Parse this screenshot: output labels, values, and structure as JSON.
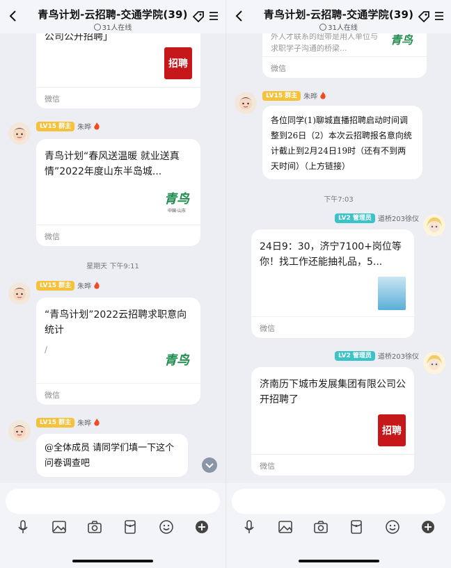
{
  "left": {
    "header": {
      "title": "青鸟计划-云招聘-交通学院(39)",
      "online": "31人在线"
    },
    "card0": {
      "text": "公司公开招聘」",
      "logo": "招聘",
      "footer": "微信"
    },
    "msg1": {
      "level": "LV15 群主",
      "name": "朱晔",
      "text": "青鸟计划“春风送温暖 就业送真情”2022年度山东半岛城...",
      "logo": "青鸟",
      "logo_sub": "中国·山东",
      "footer": "微信"
    },
    "time1": "星期天 下午9:11",
    "msg2": {
      "level": "LV15 群主",
      "name": "朱晔",
      "text": "“青鸟计划”2022云招聘求职意向统计",
      "sub": "/",
      "logo": "青鸟",
      "footer": "微信"
    },
    "msg3": {
      "level": "LV15 群主",
      "name": "朱晔",
      "text": "@全体成员 请同学们填一下这个问卷调查吧"
    }
  },
  "right": {
    "header": {
      "title": "青鸟计划-云招聘-交通学院(39)",
      "online": "31人在线"
    },
    "card0": {
      "text": "外人才联系的纽带是用人单位与求职学子沟通的桥梁...",
      "logo": "青鸟",
      "footer": "微信"
    },
    "msg1": {
      "level": "LV15 群主",
      "name": "朱晔",
      "text": "各位同学(1)聊城直播招聘启动时间调整到26日（2）本次云招聘报名意向统计截止到2月24日19时（还有不到两天时间）（上方链接）"
    },
    "time1": "下午7:03",
    "msg2": {
      "level": "LV2 管理员",
      "name": "道桥203徐仪",
      "text": "24日9：30，济宁7100+岗位等你！找工作还能抽礼品，5...",
      "footer": "微信"
    },
    "msg3": {
      "level": "LV2 管理员",
      "name": "道桥203徐仪",
      "text": "济南历下城市发展集团有限公司公开招聘了",
      "logo": "招聘",
      "footer": "微信"
    }
  },
  "icons": [
    "back-icon",
    "tag-icon",
    "menu-icon",
    "mic-icon",
    "image-icon",
    "camera-icon",
    "redpacket-icon",
    "emoji-icon",
    "plus-icon",
    "fire-icon"
  ],
  "colors": {
    "owner_badge": "#f6c23b",
    "admin_badge": "#3bc3c7",
    "logo_red": "#c6171b",
    "logo_green": "#1f8b4d"
  }
}
